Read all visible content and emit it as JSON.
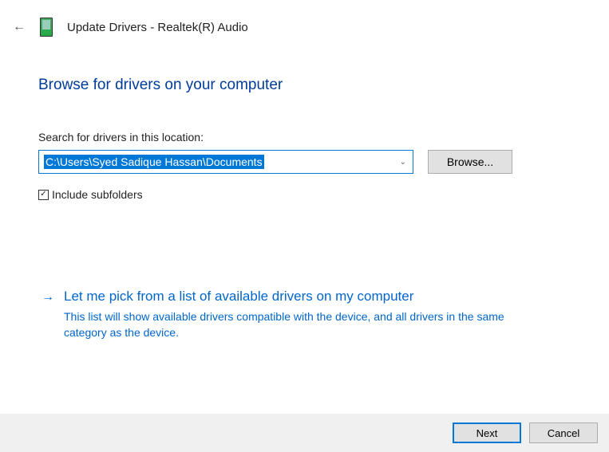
{
  "header": {
    "title": "Update Drivers - Realtek(R) Audio"
  },
  "main": {
    "heading": "Browse for drivers on your computer",
    "search_label": "Search for drivers in this location:",
    "path_value": "C:\\Users\\Syed Sadique Hassan\\Documents",
    "browse_button": "Browse...",
    "include_subfolders_label": "Include subfolders",
    "include_subfolders_checked": true
  },
  "option": {
    "title": "Let me pick from a list of available drivers on my computer",
    "description": "This list will show available drivers compatible with the device, and all drivers in the same category as the device."
  },
  "footer": {
    "next": "Next",
    "cancel": "Cancel"
  }
}
